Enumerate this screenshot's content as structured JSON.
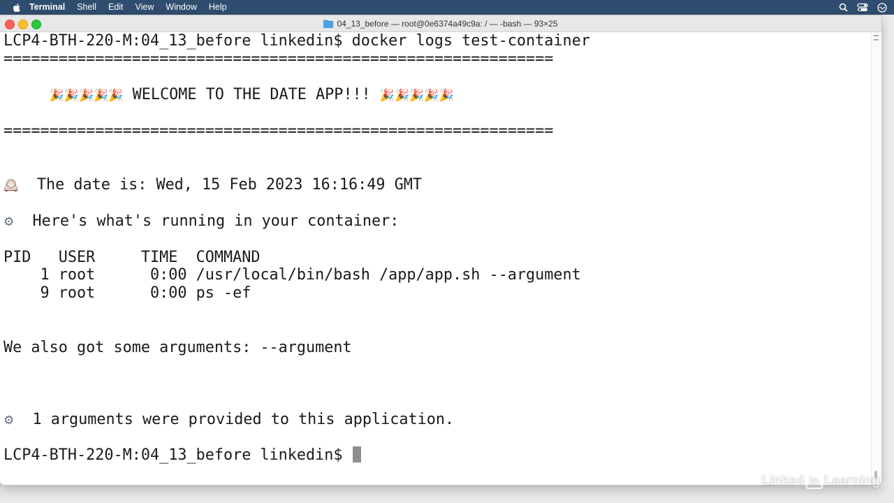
{
  "menubar": {
    "app_name": "Terminal",
    "items": [
      "Shell",
      "Edit",
      "View",
      "Window",
      "Help"
    ]
  },
  "window": {
    "title": "04_13_before — root@0e6374a49c9a: / — -bash — 93×25"
  },
  "terminal": {
    "lines": [
      "LCP4-BTH-220-M:04_13_before linkedin$ docker logs test-container",
      "============================================================",
      "",
      "WELCOME TO THE DATE APP!!!",
      "",
      "============================================================",
      "",
      "",
      "The date is: Wed, 15 Feb 2023 16:16:49 GMT",
      "",
      "Here's what's running in your container:",
      "",
      "PID   USER     TIME  COMMAND",
      "    1 root      0:00 /usr/local/bin/bash /app/app.sh --argument",
      "    9 root      0:00 ps -ef",
      "",
      "",
      "We also got some arguments: --argument",
      "",
      "",
      "",
      "1 arguments were provided to this application.",
      "",
      "LCP4-BTH-220-M:04_13_before linkedin$ "
    ],
    "welcome_emoji": "🎉🎉🎉🎉🎉",
    "clock_emoji": "🕰",
    "gear_emoji": "⚙"
  },
  "watermark": {
    "prefix": "Linked",
    "box": "in",
    "suffix": "Learning"
  },
  "colors": {
    "menubar_bg": "#2f4d6e",
    "terminal_bg": "#ffffff",
    "text": "#1a1a1a",
    "cursor": "#8e8e8e"
  }
}
